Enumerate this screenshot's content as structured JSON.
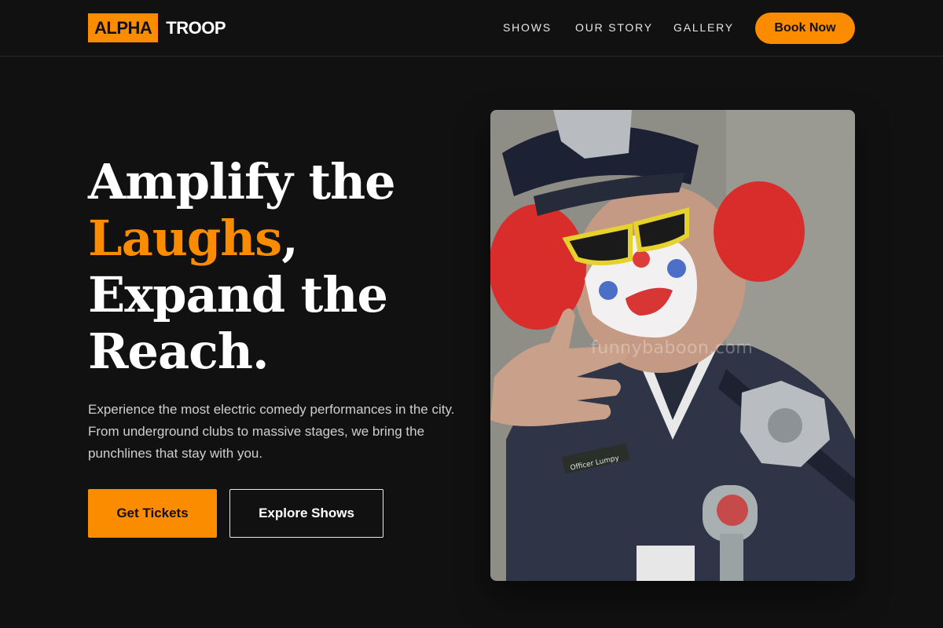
{
  "brand": {
    "logo_box": "ALPHA",
    "logo_text": "TROOP",
    "accent_color": "#fb8c00"
  },
  "nav": {
    "items": [
      {
        "label": "SHOWS"
      },
      {
        "label": "OUR STORY"
      },
      {
        "label": "GALLERY"
      }
    ],
    "cta_label": "Book Now"
  },
  "hero": {
    "headline_line1": "Amplify the",
    "headline_accent": "Laughs",
    "headline_comma": ",",
    "headline_line3": "Expand the",
    "headline_line4": "Reach.",
    "description": "Experience the most electric comedy performances in the city. From underground clubs to massive stages, we bring the punchlines that stay with you.",
    "primary_button": "Get Tickets",
    "secondary_button": "Explore Shows",
    "image": {
      "subject": "clown-police-officer-photo",
      "watermark": "funnybaboon.com",
      "name_tag": "Officer Lumpy"
    }
  }
}
